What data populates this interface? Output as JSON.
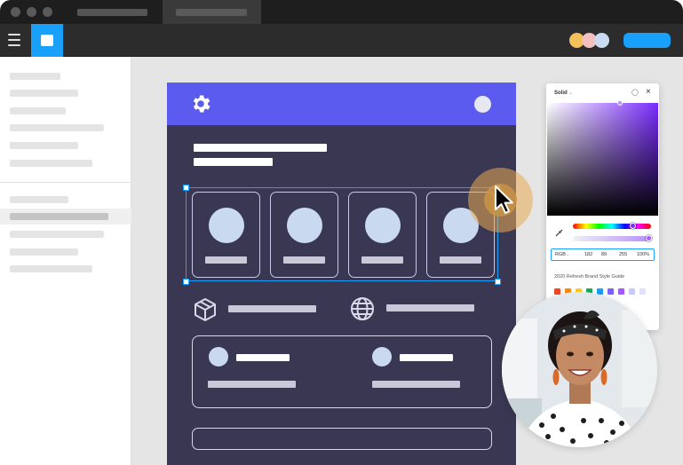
{
  "window": {
    "title_dots": 3
  },
  "tabs": [
    {
      "name": "tab-1",
      "active": true
    },
    {
      "name": "tab-2",
      "active": false
    }
  ],
  "toolbar": {
    "menu_icon": "hamburger-icon",
    "app_icon": "frame-icon",
    "avatars": [
      "#f5c05a",
      "#f3c0bf",
      "#c9dbf3"
    ],
    "accent": "#18a0fb"
  },
  "canvas": {
    "frame_bg": "#3a3752",
    "header_bg": "#5b5bf0",
    "header_icon": "gear-icon",
    "features": [
      {
        "icon": "box-icon"
      },
      {
        "icon": "globe-icon"
      }
    ]
  },
  "color_picker": {
    "mode": "Solid",
    "format": "RGB",
    "r": "182",
    "g": "89",
    "b": "255",
    "alpha": "100%",
    "library": "2020 Refresh Brand Style Guide",
    "swatches": [
      "#f24822",
      "#ff8a00",
      "#ffcd29",
      "#14ae5c",
      "#18a0fb",
      "#7b61ff",
      "#a259ff",
      "#c9c9ff",
      "#e0e0ff"
    ]
  }
}
